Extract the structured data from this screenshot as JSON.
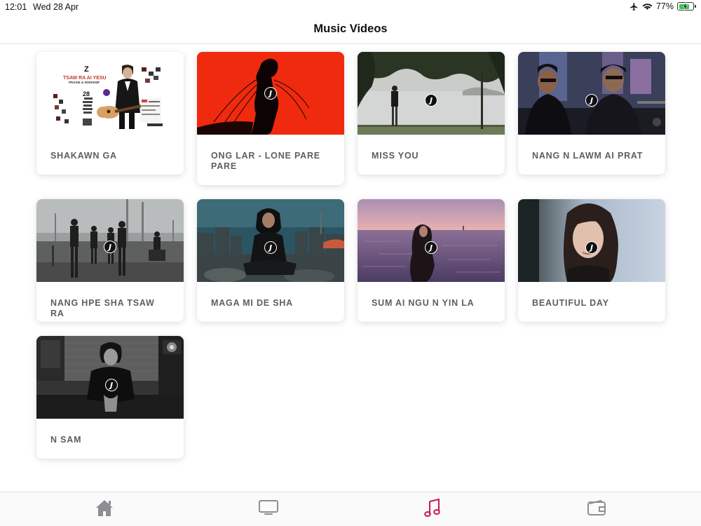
{
  "status_bar": {
    "time": "12:01",
    "date": "Wed 28 Apr",
    "battery_text": "77%",
    "battery_level": 0.77,
    "icons": [
      "airplane-icon",
      "wifi-icon",
      "battery-charging-icon"
    ]
  },
  "nav": {
    "title": "Music Videos"
  },
  "videos": [
    {
      "title": "SHAKAWN GA"
    },
    {
      "title": "ONG LAR - LONE PARE PARE"
    },
    {
      "title": "MISS YOU"
    },
    {
      "title": "NANG N LAWM AI PRAT"
    },
    {
      "title": "NANG HPE SHA TSAW RA"
    },
    {
      "title": "MAGA MI DE SHA"
    },
    {
      "title": "SUM AI NGU N YIN LA"
    },
    {
      "title": "BEAUTIFUL DAY"
    },
    {
      "title": "N SAM"
    }
  ],
  "thumbnail_logo": "J",
  "poster_text": {
    "brand": "Z",
    "headline": "TSAW RA AI YESU",
    "subline": "PRAISE & WORSHIP",
    "number": "28"
  },
  "tab_bar": {
    "tabs": [
      {
        "icon": "home-icon",
        "active": false
      },
      {
        "icon": "tv-icon",
        "active": false
      },
      {
        "icon": "music-note-icon",
        "active": true
      },
      {
        "icon": "wallet-icon",
        "active": false
      }
    ],
    "active_color": "#c8174f",
    "inactive_color": "#8e8e93"
  }
}
